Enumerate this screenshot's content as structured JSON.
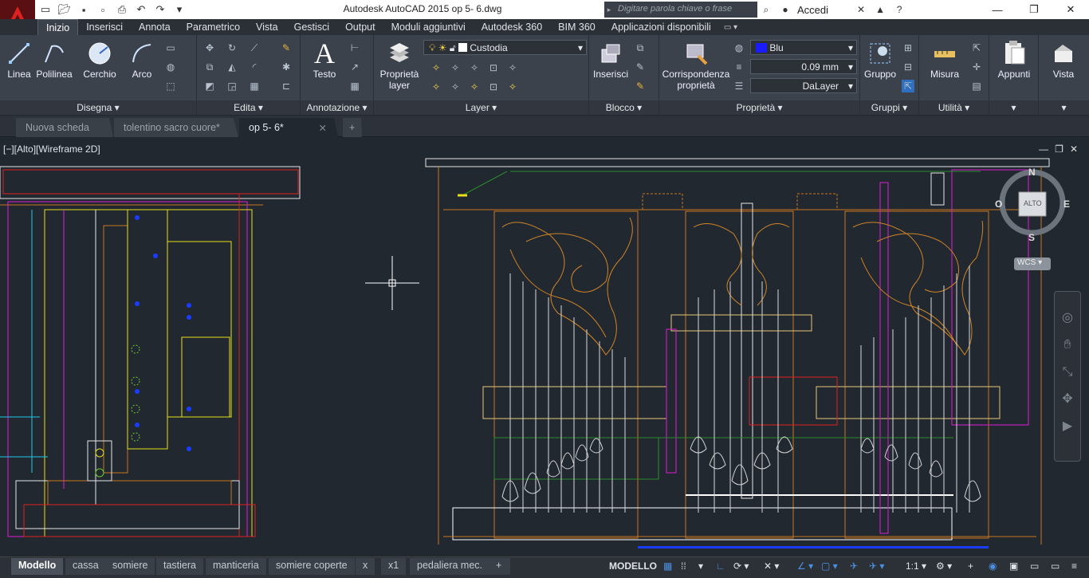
{
  "title": {
    "app_title": "Autodesk AutoCAD 2015    op 5- 6.dwg",
    "search_placeholder": "Digitare parola chiave o frase",
    "signin": "Accedi"
  },
  "ribbon_tabs": [
    "Inizio",
    "Inserisci",
    "Annota",
    "Parametrico",
    "Vista",
    "Gestisci",
    "Output",
    "Moduli aggiuntivi",
    "Autodesk 360",
    "BIM 360",
    "Applicazioni disponibili"
  ],
  "panels": {
    "disegna": {
      "title": "Disegna",
      "tools": [
        "Linea",
        "Polilinea",
        "Cerchio",
        "Arco"
      ]
    },
    "edita": {
      "title": "Edita"
    },
    "annotazione": {
      "title": "Annotazione",
      "testo": "Testo"
    },
    "layer": {
      "title": "Layer",
      "prop_layer_1": "Proprietà",
      "prop_layer_2": "layer",
      "current_layer": "Custodia"
    },
    "blocco": {
      "title": "Blocco",
      "inserisci": "Inserisci"
    },
    "proprieta": {
      "title": "Proprietà",
      "corr_1": "Corrispondenza",
      "corr_2": "proprietà",
      "color": "Blu",
      "lineweight": "0.09 mm",
      "linetype": "DaLayer"
    },
    "gruppi": {
      "title": "Gruppi",
      "gruppo": "Gruppo"
    },
    "utilita": {
      "title": "Utilità",
      "misura": "Misura"
    },
    "appunti": {
      "title": "Appunti"
    },
    "vista": {
      "title": "Vista"
    }
  },
  "doc_tabs": [
    "Nuova scheda",
    "tolentino sacro cuore*",
    "op 5- 6*"
  ],
  "viewport": {
    "label": "[−][Alto][Wireframe 2D]",
    "viewcube": {
      "top": "ALTO",
      "n": "N",
      "s": "S",
      "e": "E",
      "o": "O",
      "wcs": "WCS"
    }
  },
  "layout_tabs": [
    "Modello",
    "cassa",
    "somiere",
    "tastiera",
    "manticeria",
    "somiere coperte",
    "x",
    "x1",
    "pedaliera mec."
  ],
  "status": {
    "space": "MODELLO",
    "scale": "1:1"
  },
  "colors": {
    "accent_blue": "#2f6fbf",
    "background": "#212830",
    "layer_orange": "#c8761e",
    "layer_yellow": "#e6e01c",
    "layer_magenta": "#e01ad8"
  }
}
